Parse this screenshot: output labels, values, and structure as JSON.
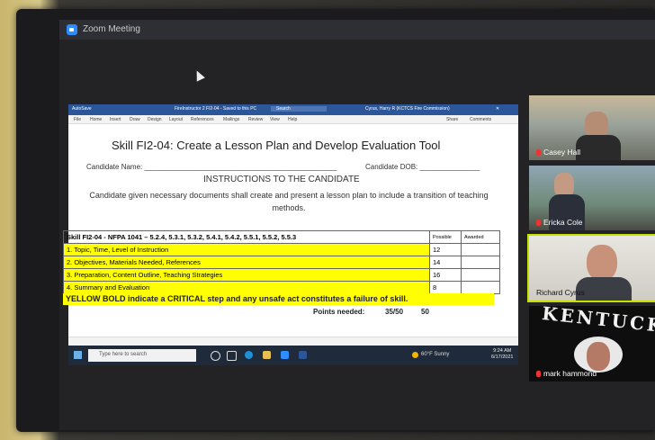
{
  "zoom": {
    "title": "Zoom Meeting"
  },
  "word": {
    "autosave": "AutoSave",
    "doc_title": "FireInstructor 2 FI2-04 - Saved to this PC",
    "search": "Search",
    "user": "Cyrus, Harry R (KCTCS Fire Commission)",
    "share": "Share",
    "comments": "Comments",
    "ribbon": [
      "File",
      "Home",
      "Insert",
      "Draw",
      "Design",
      "Layout",
      "References",
      "Mailings",
      "Review",
      "View",
      "Help"
    ]
  },
  "doc": {
    "title": "Skill FI2-04:  Create a Lesson Plan and Develop Evaluation Tool",
    "candidate_name": "Candidate Name: ________________________________________________",
    "candidate_dob": "Candidate DOB: _______________",
    "instructions": "INSTRUCTIONS TO THE CANDIDATE",
    "description": "Candidate given necessary documents shall create and present a lesson plan to include a transition of teaching methods.",
    "table": {
      "header": "Skill FI2-04 - NFPA 1041 – 5.2.4, 5.3.1, 5.3.2, 5.4.1, 5.4.2, 5.5.1, 5.5.2, 5.5.3",
      "col_possible": "Possible",
      "col_awarded": "Awarded",
      "rows": [
        {
          "label": "1.  Topic, Time, Level of Instruction",
          "possible": "12"
        },
        {
          "label": "2.  Objectives, Materials Needed, References",
          "possible": "14"
        },
        {
          "label": "3.  Preparation, Content Outline, Teaching Strategies",
          "possible": "16"
        },
        {
          "label": "4.  Summary and Evaluation",
          "possible": "8"
        }
      ]
    },
    "critical_note": "YELLOW BOLD indicate a CRITICAL step and any unsafe act constitutes a failure of skill.",
    "points_needed_label": "Points needed:",
    "points_needed_value": "35/50",
    "points_total": "50"
  },
  "taskbar": {
    "search_placeholder": "Type here to search",
    "weather": "60°F  Sunny",
    "time": "9:24 AM",
    "date": "6/17/2021"
  },
  "participants": [
    {
      "name": "Casey Hall"
    },
    {
      "name": "Ericka Cole"
    },
    {
      "name": "Richard Cyrus"
    },
    {
      "name": "mark hammond"
    }
  ],
  "logo_text": "KENTUCKY"
}
